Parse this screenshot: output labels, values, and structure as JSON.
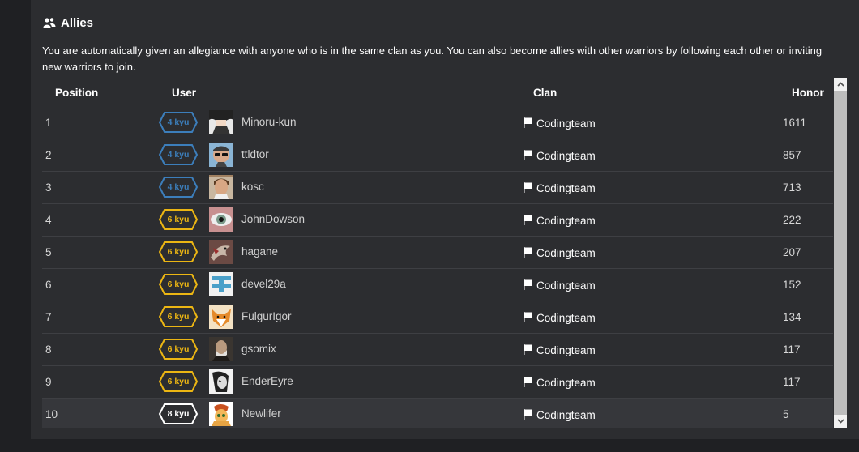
{
  "section": {
    "title": "Allies",
    "description": "You are automatically given an allegiance with anyone who is in the same clan as you. You can also become allies with other warriors by following each other or inviting new warriors to join."
  },
  "table": {
    "headers": {
      "position": "Position",
      "user": "User",
      "clan": "Clan",
      "honor": "Honor"
    },
    "rows": [
      {
        "position": "1",
        "rank": "4 kyu",
        "rank_color": "#3c7ebb",
        "username": "Minoru-kun",
        "clan": "Codingteam",
        "honor": "1611",
        "avatar": "avatar-anime-character"
      },
      {
        "position": "2",
        "rank": "4 kyu",
        "rank_color": "#3c7ebb",
        "username": "ttldtor",
        "clan": "Codingteam",
        "honor": "857",
        "avatar": "avatar-man-sunglasses"
      },
      {
        "position": "3",
        "rank": "4 kyu",
        "rank_color": "#3c7ebb",
        "username": "kosc",
        "clan": "Codingteam",
        "honor": "713",
        "avatar": "avatar-man-photo"
      },
      {
        "position": "4",
        "rank": "6 kyu",
        "rank_color": "#ecb613",
        "username": "JohnDowson",
        "clan": "Codingteam",
        "honor": "222",
        "avatar": "avatar-eye-closeup"
      },
      {
        "position": "5",
        "rank": "6 kyu",
        "rank_color": "#ecb613",
        "username": "hagane",
        "clan": "Codingteam",
        "honor": "207",
        "avatar": "avatar-dragon-art"
      },
      {
        "position": "6",
        "rank": "6 kyu",
        "rank_color": "#ecb613",
        "username": "devel29a",
        "clan": "Codingteam",
        "honor": "152",
        "avatar": "avatar-identicon"
      },
      {
        "position": "7",
        "rank": "6 kyu",
        "rank_color": "#ecb613",
        "username": "FulgurIgor",
        "clan": "Codingteam",
        "honor": "134",
        "avatar": "avatar-fox"
      },
      {
        "position": "8",
        "rank": "6 kyu",
        "rank_color": "#ecb613",
        "username": "gsomix",
        "clan": "Codingteam",
        "honor": "117",
        "avatar": "avatar-old-portrait"
      },
      {
        "position": "9",
        "rank": "6 kyu",
        "rank_color": "#ecb613",
        "username": "EnderEyre",
        "clan": "Codingteam",
        "honor": "117",
        "avatar": "avatar-sketch-face"
      },
      {
        "position": "10",
        "rank": "8 kyu",
        "rank_color": "#ffffff",
        "username": "Newlifer",
        "clan": "Codingteam",
        "honor": "5",
        "avatar": "avatar-pony"
      }
    ]
  }
}
